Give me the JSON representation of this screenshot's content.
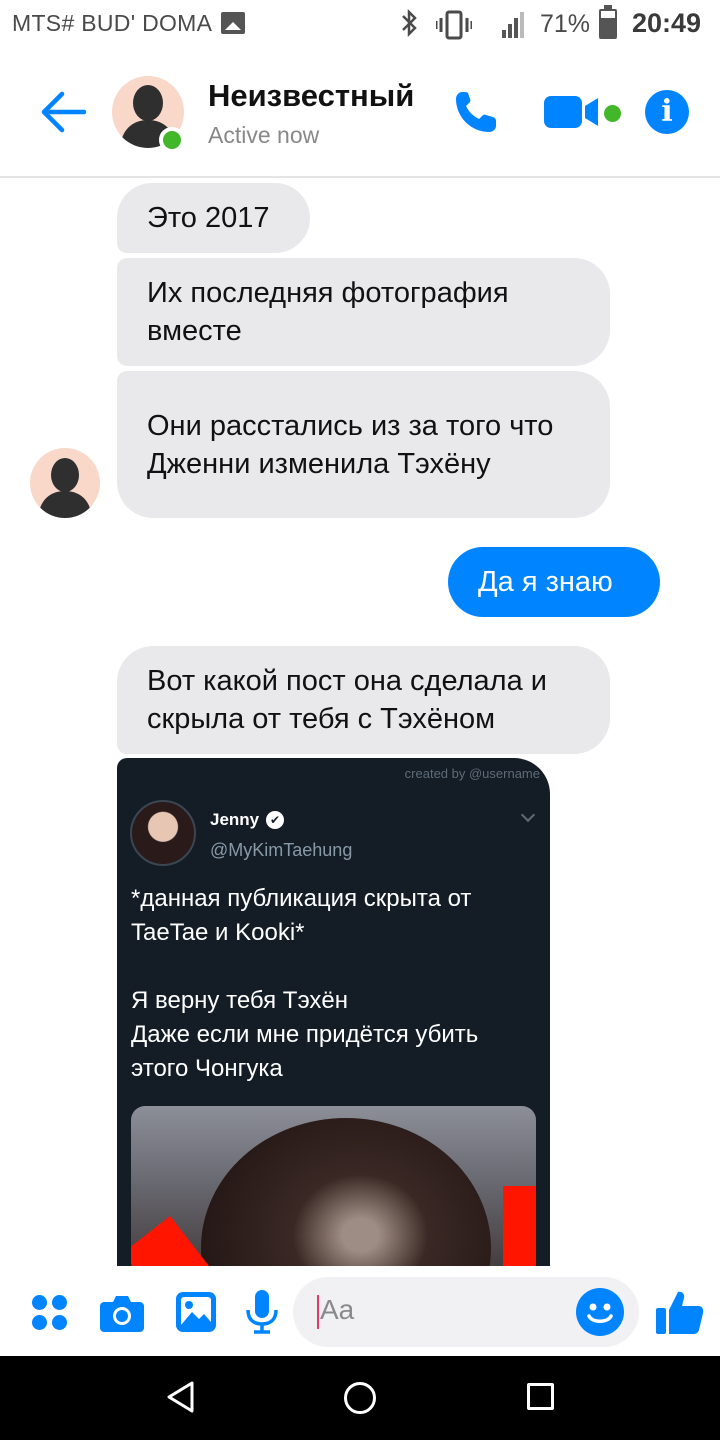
{
  "status_bar": {
    "carrier": "MTS# BUD' DOMA",
    "battery": "71%",
    "time": "20:49",
    "icons": [
      "image-icon",
      "bluetooth-icon",
      "vibrate-icon",
      "signal-icon",
      "battery-icon"
    ]
  },
  "header": {
    "name": "Неизвестный",
    "status": "Active now",
    "info_glyph": "i",
    "colors": {
      "accent": "#0084ff",
      "online": "#42b72a"
    }
  },
  "messages": [
    {
      "from": "them",
      "text": "Это 2017"
    },
    {
      "from": "them",
      "text": "Их последняя фотография вместе"
    },
    {
      "from": "them",
      "text": "Они расстались из за того что Дженни изменила Тэхёну"
    },
    {
      "from": "me",
      "text": "Да я знаю"
    },
    {
      "from": "them",
      "text": "Вот какой пост она сделала и скрыла от тебя с Тэхёном"
    }
  ],
  "shared_image": {
    "watermark": "created by @username",
    "tweet": {
      "name": "Jenny",
      "verified_glyph": "✔",
      "handle": "@MyKimTaehung",
      "text": "*данная публикация скрыта от TaeTae и Kooki*\n\nЯ верну тебя Тэхён\nДаже если мне придётся убить этого Чонгука"
    }
  },
  "composer": {
    "placeholder": "Aa"
  },
  "colors": {
    "incoming_bubble": "#e9e9eb",
    "outgoing_bubble": "#0084ff",
    "tweet_bg": "#141d26"
  }
}
